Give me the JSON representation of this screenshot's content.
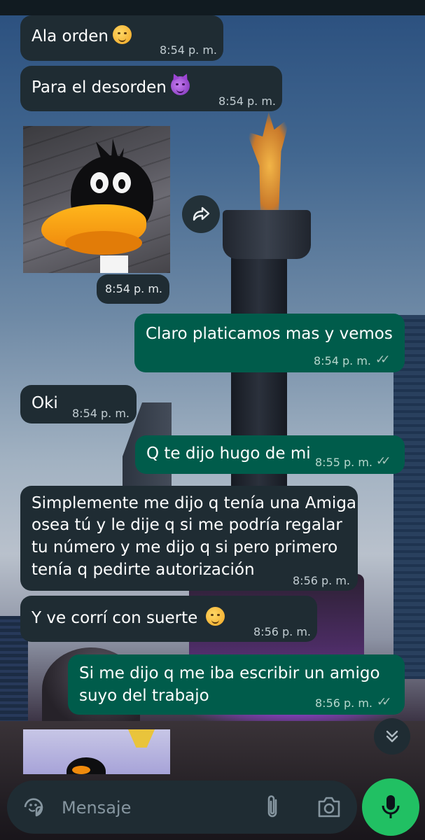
{
  "colors": {
    "incoming_bubble": "#1f2c33",
    "outgoing_bubble": "#005c4b",
    "mic_button": "#21c063",
    "input_bar": "#1f2c33"
  },
  "messages": [
    {
      "direction": "incoming",
      "text": "Ala orden",
      "emoji": "saluting-face",
      "time": "8:54 p. m."
    },
    {
      "direction": "incoming",
      "text": "Para el desorden",
      "emoji": "smiling-devil",
      "time": "8:54 p. m."
    },
    {
      "direction": "incoming",
      "type": "image",
      "image": "daffy-duck-sticker",
      "time": "8:54 p. m."
    },
    {
      "direction": "outgoing",
      "text": "Claro platicamos mas y vemos",
      "time": "8:54 p. m.",
      "status": "read"
    },
    {
      "direction": "incoming",
      "text": "Oki",
      "time": "8:54 p. m."
    },
    {
      "direction": "outgoing",
      "text": "Q te dijo hugo de mi",
      "time": "8:55 p. m.",
      "status": "read"
    },
    {
      "direction": "incoming",
      "lines": [
        "Simplemente me dijo q tenía una Amiga",
        "osea tú y le dije q si me podría regalar",
        "tu número y me dijo q si pero primero",
        "tenía q pedirte autorización"
      ],
      "time": "8:56 p. m."
    },
    {
      "direction": "incoming",
      "text": "Y ve corrí con suerte",
      "emoji": "smiling-face",
      "time": "8:56 p. m."
    },
    {
      "direction": "outgoing",
      "lines": [
        "Si me dijo q me iba escribir un amigo",
        "suyo del trabajo"
      ],
      "time": "8:56 p. m.",
      "status": "read"
    },
    {
      "direction": "incoming",
      "type": "image",
      "image": "daffy-duck-image-partial"
    }
  ],
  "icons": {
    "forward": "forward-icon",
    "scroll_down": "double-chevron-down-icon",
    "sticker": "sticker-icon",
    "attach": "paperclip-icon",
    "camera": "camera-icon",
    "mic": "microphone-icon",
    "read_receipt": "double-check-icon"
  },
  "composer": {
    "placeholder": "Mensaje",
    "value": ""
  }
}
